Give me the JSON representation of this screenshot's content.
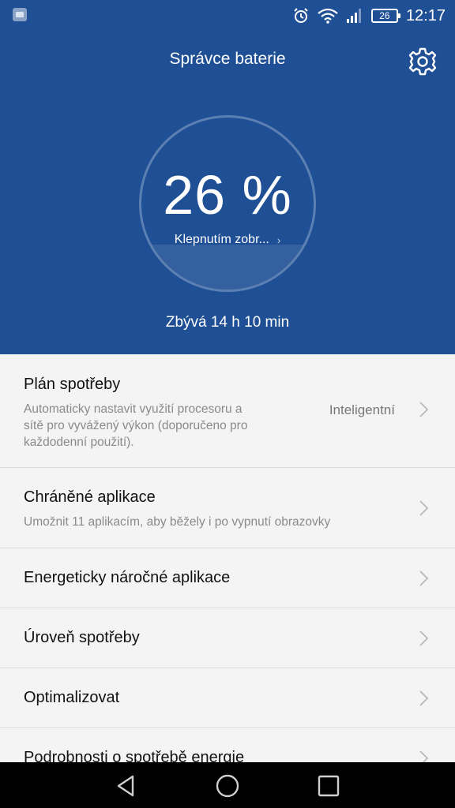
{
  "status_bar": {
    "icons": [
      "gallery-notification-icon",
      "alarm-icon",
      "wifi-icon",
      "signal-icon",
      "battery-icon"
    ],
    "battery_level": "26",
    "time": "12:17"
  },
  "header": {
    "title": "Správce baterie",
    "settings_icon": "gear-icon",
    "percent": "26 %",
    "battery_fraction": 0.26,
    "details_link": "Klepnutím zobr...",
    "remaining": "Zbývá 14 h 10 min"
  },
  "list": {
    "items": [
      {
        "title": "Plán spotřeby",
        "subtitle_lines": [
          "Automaticky nastavit využití procesoru a",
          "sítě pro vyvážený výkon (doporučeno pro",
          "každodenní použití)."
        ],
        "value": "Inteligentní"
      },
      {
        "title": "Chráněné aplikace",
        "subtitle_lines": [
          "Umožnit 11 aplikacím, aby běžely i po vypnutí obrazovky"
        ]
      },
      {
        "title": "Energeticky náročné aplikace"
      },
      {
        "title": "Úroveň spotřeby"
      },
      {
        "title": "Optimalizovat"
      },
      {
        "title": "Podrobnosti o spotřebě energie"
      }
    ]
  },
  "nav_bar": {
    "icons": [
      "back-icon",
      "home-icon",
      "recents-icon"
    ]
  },
  "colors": {
    "header_bg": "#1f4f95",
    "list_bg": "#f4f4f4",
    "text_primary": "#111111",
    "text_secondary": "#8a8a8a"
  }
}
